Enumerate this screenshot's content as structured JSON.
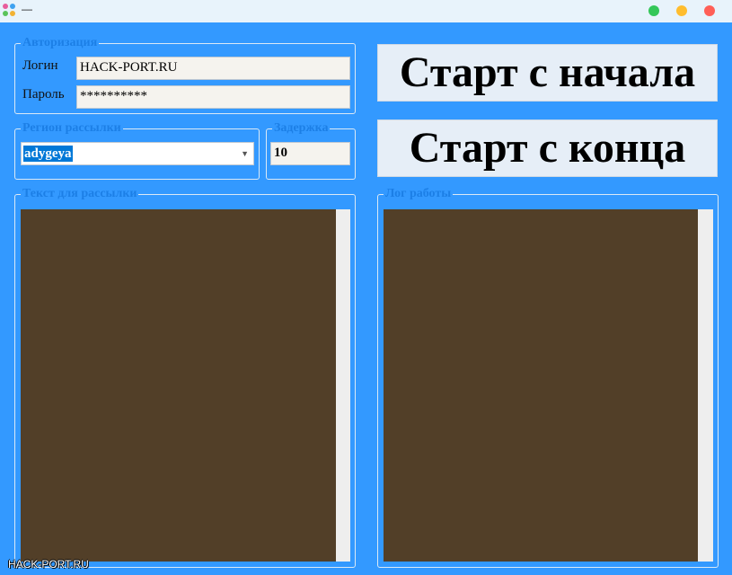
{
  "window": {
    "title": "—",
    "controls": [
      {
        "name": "maximize",
        "color": "#34c759"
      },
      {
        "name": "minimize",
        "color": "#ffbd2e"
      },
      {
        "name": "close",
        "color": "#ff5f57"
      }
    ]
  },
  "auth": {
    "legend": "Авторизация",
    "login_label": "Логин",
    "login_value": "HACK-PORT.RU",
    "password_label": "Пароль",
    "password_value": "**********"
  },
  "region": {
    "legend": "Регион рассылки",
    "selected": "adygeya"
  },
  "delay": {
    "legend": "Задержка",
    "value": "10"
  },
  "buttons": {
    "start_begin": "Старт с начала",
    "start_end": "Старт с конца"
  },
  "message": {
    "legend": "Текст для рассылки",
    "text": ""
  },
  "log": {
    "legend": "Лог работы",
    "text": ""
  },
  "watermark": "HACK-PORT.RU",
  "colors": {
    "background": "#3399ff",
    "textarea": "#523f28",
    "legend": "#1c7fe6"
  }
}
